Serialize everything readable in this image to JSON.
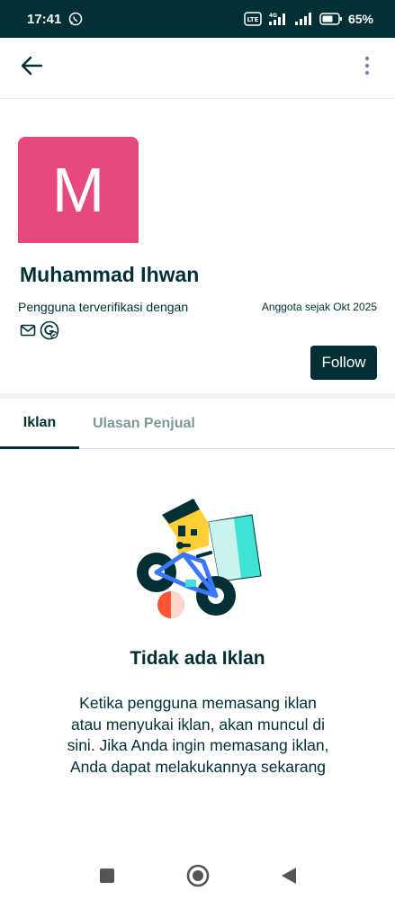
{
  "status_bar": {
    "time": "17:41",
    "network": "4G",
    "volte": "Vo LTE",
    "battery": "65%"
  },
  "app_bar": {
    "back_icon": "arrow-left-icon",
    "menu_icon": "more-vertical-icon"
  },
  "profile": {
    "avatar_letter": "M",
    "avatar_color": "#e8497c",
    "name": "Muhammad Ihwan",
    "verified_text": "Pengguna terverifikasi dengan",
    "member_since": "Anggota sejak Okt 2025",
    "verify_icons": [
      "mail-icon",
      "google-icon"
    ],
    "follow_label": "Follow"
  },
  "tabs": [
    {
      "label": "Iklan",
      "active": true
    },
    {
      "label": "Ulasan Penjual",
      "active": false
    }
  ],
  "empty_state": {
    "title": "Tidak ada Iklan",
    "lines": [
      "Ketika pengguna memasang iklan",
      "atau menyukai iklan, akan muncul di",
      "sini. Jika Anda ingin memasang iklan,",
      "Anda dapat melakukannya sekarang"
    ]
  },
  "nav_bar": {
    "recent_icon": "square-icon",
    "home_icon": "circle-home-icon",
    "back_icon": "triangle-back-icon"
  },
  "colors": {
    "primary": "#002f34",
    "avatar": "#e8497c",
    "muted": "#7f9799"
  }
}
